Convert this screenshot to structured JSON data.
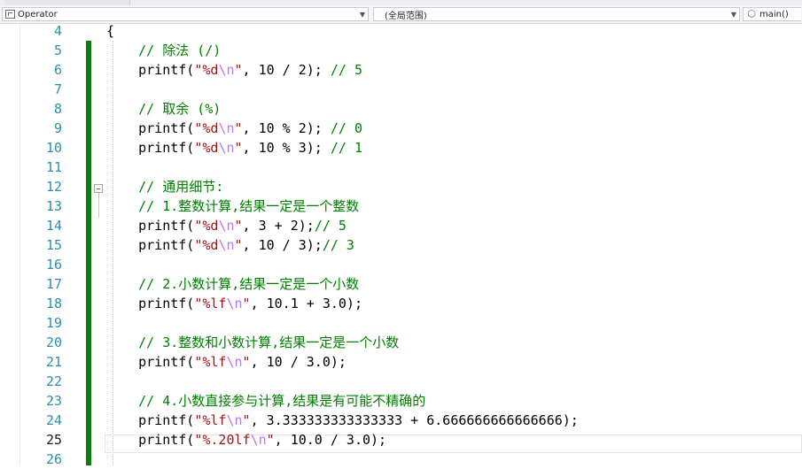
{
  "navbar": {
    "project_combo": "Operator",
    "scope_combo": "(全局范围)",
    "member_combo": "main()"
  },
  "editor": {
    "current_line": "25",
    "lines": [
      {
        "n": "4",
        "code": [
          {
            "t": "{",
            "c": "plain"
          }
        ]
      },
      {
        "n": "5",
        "code": [
          {
            "t": "    ",
            "c": "plain"
          },
          {
            "t": "// 除法 (/)",
            "c": "cmt"
          }
        ]
      },
      {
        "n": "6",
        "code": [
          {
            "t": "    printf(",
            "c": "plain"
          },
          {
            "t": "\"%d",
            "c": "str"
          },
          {
            "t": "\\n",
            "c": "esc"
          },
          {
            "t": "\"",
            "c": "str"
          },
          {
            "t": ", 10 / 2); ",
            "c": "plain"
          },
          {
            "t": "// 5",
            "c": "cmt"
          }
        ]
      },
      {
        "n": "7",
        "code": []
      },
      {
        "n": "8",
        "code": [
          {
            "t": "    ",
            "c": "plain"
          },
          {
            "t": "// 取余 (%)",
            "c": "cmt"
          }
        ]
      },
      {
        "n": "9",
        "code": [
          {
            "t": "    printf(",
            "c": "plain"
          },
          {
            "t": "\"%d",
            "c": "str"
          },
          {
            "t": "\\n",
            "c": "esc"
          },
          {
            "t": "\"",
            "c": "str"
          },
          {
            "t": ", 10 % 2); ",
            "c": "plain"
          },
          {
            "t": "// 0",
            "c": "cmt"
          }
        ]
      },
      {
        "n": "10",
        "code": [
          {
            "t": "    printf(",
            "c": "plain"
          },
          {
            "t": "\"%d",
            "c": "str"
          },
          {
            "t": "\\n",
            "c": "esc"
          },
          {
            "t": "\"",
            "c": "str"
          },
          {
            "t": ", 10 % 3); ",
            "c": "plain"
          },
          {
            "t": "// 1",
            "c": "cmt"
          }
        ]
      },
      {
        "n": "11",
        "code": []
      },
      {
        "n": "12",
        "code": [
          {
            "t": "    ",
            "c": "plain"
          },
          {
            "t": "// 通用细节:",
            "c": "cmt"
          }
        ]
      },
      {
        "n": "13",
        "code": [
          {
            "t": "    ",
            "c": "plain"
          },
          {
            "t": "// 1.整数计算,结果一定是一个整数",
            "c": "cmt"
          }
        ]
      },
      {
        "n": "14",
        "code": [
          {
            "t": "    printf(",
            "c": "plain"
          },
          {
            "t": "\"%d",
            "c": "str"
          },
          {
            "t": "\\n",
            "c": "esc"
          },
          {
            "t": "\"",
            "c": "str"
          },
          {
            "t": ", 3 + 2);",
            "c": "plain"
          },
          {
            "t": "// 5",
            "c": "cmt"
          }
        ]
      },
      {
        "n": "15",
        "code": [
          {
            "t": "    printf(",
            "c": "plain"
          },
          {
            "t": "\"%d",
            "c": "str"
          },
          {
            "t": "\\n",
            "c": "esc"
          },
          {
            "t": "\"",
            "c": "str"
          },
          {
            "t": ", 10 / 3);",
            "c": "plain"
          },
          {
            "t": "// 3",
            "c": "cmt"
          }
        ]
      },
      {
        "n": "16",
        "code": []
      },
      {
        "n": "17",
        "code": [
          {
            "t": "    ",
            "c": "plain"
          },
          {
            "t": "// 2.小数计算,结果一定是一个小数",
            "c": "cmt"
          }
        ]
      },
      {
        "n": "18",
        "code": [
          {
            "t": "    printf(",
            "c": "plain"
          },
          {
            "t": "\"%lf",
            "c": "str"
          },
          {
            "t": "\\n",
            "c": "esc"
          },
          {
            "t": "\"",
            "c": "str"
          },
          {
            "t": ", 10.1 + 3.0);",
            "c": "plain"
          }
        ]
      },
      {
        "n": "19",
        "code": []
      },
      {
        "n": "20",
        "code": [
          {
            "t": "    ",
            "c": "plain"
          },
          {
            "t": "// 3.整数和小数计算,结果一定是一个小数",
            "c": "cmt"
          }
        ]
      },
      {
        "n": "21",
        "code": [
          {
            "t": "    printf(",
            "c": "plain"
          },
          {
            "t": "\"%lf",
            "c": "str"
          },
          {
            "t": "\\n",
            "c": "esc"
          },
          {
            "t": "\"",
            "c": "str"
          },
          {
            "t": ", 10 / 3.0);",
            "c": "plain"
          }
        ]
      },
      {
        "n": "22",
        "code": []
      },
      {
        "n": "23",
        "code": [
          {
            "t": "    ",
            "c": "plain"
          },
          {
            "t": "// 4.小数直接参与计算,结果是有可能不精确的",
            "c": "cmt"
          }
        ]
      },
      {
        "n": "24",
        "code": [
          {
            "t": "    printf(",
            "c": "plain"
          },
          {
            "t": "\"%lf",
            "c": "str"
          },
          {
            "t": "\\n",
            "c": "esc"
          },
          {
            "t": "\"",
            "c": "str"
          },
          {
            "t": ", 3.333333333333333 + 6.666666666666666);",
            "c": "plain"
          }
        ]
      },
      {
        "n": "25",
        "code": [
          {
            "t": "    printf(",
            "c": "plain"
          },
          {
            "t": "\"%.20lf",
            "c": "str"
          },
          {
            "t": "\\n",
            "c": "esc"
          },
          {
            "t": "\"",
            "c": "str"
          },
          {
            "t": ", 10.0 / 3.0);",
            "c": "plain"
          }
        ]
      },
      {
        "n": "26",
        "code": []
      }
    ]
  },
  "colors": {
    "keyword_text": "#000000",
    "comment": "#008000",
    "string": "#a31515",
    "escape": "#b776fb",
    "line_number": "#2b91af",
    "change_bar": "#107c10"
  }
}
